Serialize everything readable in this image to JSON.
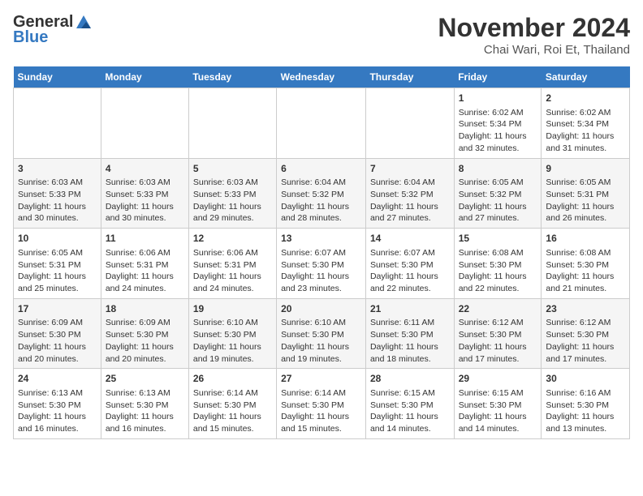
{
  "header": {
    "logo_general": "General",
    "logo_blue": "Blue",
    "title": "November 2024",
    "subtitle": "Chai Wari, Roi Et, Thailand"
  },
  "weekdays": [
    "Sunday",
    "Monday",
    "Tuesday",
    "Wednesday",
    "Thursday",
    "Friday",
    "Saturday"
  ],
  "weeks": [
    [
      {
        "day": "",
        "info": ""
      },
      {
        "day": "",
        "info": ""
      },
      {
        "day": "",
        "info": ""
      },
      {
        "day": "",
        "info": ""
      },
      {
        "day": "",
        "info": ""
      },
      {
        "day": "1",
        "info": "Sunrise: 6:02 AM\nSunset: 5:34 PM\nDaylight: 11 hours and 32 minutes."
      },
      {
        "day": "2",
        "info": "Sunrise: 6:02 AM\nSunset: 5:34 PM\nDaylight: 11 hours and 31 minutes."
      }
    ],
    [
      {
        "day": "3",
        "info": "Sunrise: 6:03 AM\nSunset: 5:33 PM\nDaylight: 11 hours and 30 minutes."
      },
      {
        "day": "4",
        "info": "Sunrise: 6:03 AM\nSunset: 5:33 PM\nDaylight: 11 hours and 30 minutes."
      },
      {
        "day": "5",
        "info": "Sunrise: 6:03 AM\nSunset: 5:33 PM\nDaylight: 11 hours and 29 minutes."
      },
      {
        "day": "6",
        "info": "Sunrise: 6:04 AM\nSunset: 5:32 PM\nDaylight: 11 hours and 28 minutes."
      },
      {
        "day": "7",
        "info": "Sunrise: 6:04 AM\nSunset: 5:32 PM\nDaylight: 11 hours and 27 minutes."
      },
      {
        "day": "8",
        "info": "Sunrise: 6:05 AM\nSunset: 5:32 PM\nDaylight: 11 hours and 27 minutes."
      },
      {
        "day": "9",
        "info": "Sunrise: 6:05 AM\nSunset: 5:31 PM\nDaylight: 11 hours and 26 minutes."
      }
    ],
    [
      {
        "day": "10",
        "info": "Sunrise: 6:05 AM\nSunset: 5:31 PM\nDaylight: 11 hours and 25 minutes."
      },
      {
        "day": "11",
        "info": "Sunrise: 6:06 AM\nSunset: 5:31 PM\nDaylight: 11 hours and 24 minutes."
      },
      {
        "day": "12",
        "info": "Sunrise: 6:06 AM\nSunset: 5:31 PM\nDaylight: 11 hours and 24 minutes."
      },
      {
        "day": "13",
        "info": "Sunrise: 6:07 AM\nSunset: 5:30 PM\nDaylight: 11 hours and 23 minutes."
      },
      {
        "day": "14",
        "info": "Sunrise: 6:07 AM\nSunset: 5:30 PM\nDaylight: 11 hours and 22 minutes."
      },
      {
        "day": "15",
        "info": "Sunrise: 6:08 AM\nSunset: 5:30 PM\nDaylight: 11 hours and 22 minutes."
      },
      {
        "day": "16",
        "info": "Sunrise: 6:08 AM\nSunset: 5:30 PM\nDaylight: 11 hours and 21 minutes."
      }
    ],
    [
      {
        "day": "17",
        "info": "Sunrise: 6:09 AM\nSunset: 5:30 PM\nDaylight: 11 hours and 20 minutes."
      },
      {
        "day": "18",
        "info": "Sunrise: 6:09 AM\nSunset: 5:30 PM\nDaylight: 11 hours and 20 minutes."
      },
      {
        "day": "19",
        "info": "Sunrise: 6:10 AM\nSunset: 5:30 PM\nDaylight: 11 hours and 19 minutes."
      },
      {
        "day": "20",
        "info": "Sunrise: 6:10 AM\nSunset: 5:30 PM\nDaylight: 11 hours and 19 minutes."
      },
      {
        "day": "21",
        "info": "Sunrise: 6:11 AM\nSunset: 5:30 PM\nDaylight: 11 hours and 18 minutes."
      },
      {
        "day": "22",
        "info": "Sunrise: 6:12 AM\nSunset: 5:30 PM\nDaylight: 11 hours and 17 minutes."
      },
      {
        "day": "23",
        "info": "Sunrise: 6:12 AM\nSunset: 5:30 PM\nDaylight: 11 hours and 17 minutes."
      }
    ],
    [
      {
        "day": "24",
        "info": "Sunrise: 6:13 AM\nSunset: 5:30 PM\nDaylight: 11 hours and 16 minutes."
      },
      {
        "day": "25",
        "info": "Sunrise: 6:13 AM\nSunset: 5:30 PM\nDaylight: 11 hours and 16 minutes."
      },
      {
        "day": "26",
        "info": "Sunrise: 6:14 AM\nSunset: 5:30 PM\nDaylight: 11 hours and 15 minutes."
      },
      {
        "day": "27",
        "info": "Sunrise: 6:14 AM\nSunset: 5:30 PM\nDaylight: 11 hours and 15 minutes."
      },
      {
        "day": "28",
        "info": "Sunrise: 6:15 AM\nSunset: 5:30 PM\nDaylight: 11 hours and 14 minutes."
      },
      {
        "day": "29",
        "info": "Sunrise: 6:15 AM\nSunset: 5:30 PM\nDaylight: 11 hours and 14 minutes."
      },
      {
        "day": "30",
        "info": "Sunrise: 6:16 AM\nSunset: 5:30 PM\nDaylight: 11 hours and 13 minutes."
      }
    ]
  ]
}
